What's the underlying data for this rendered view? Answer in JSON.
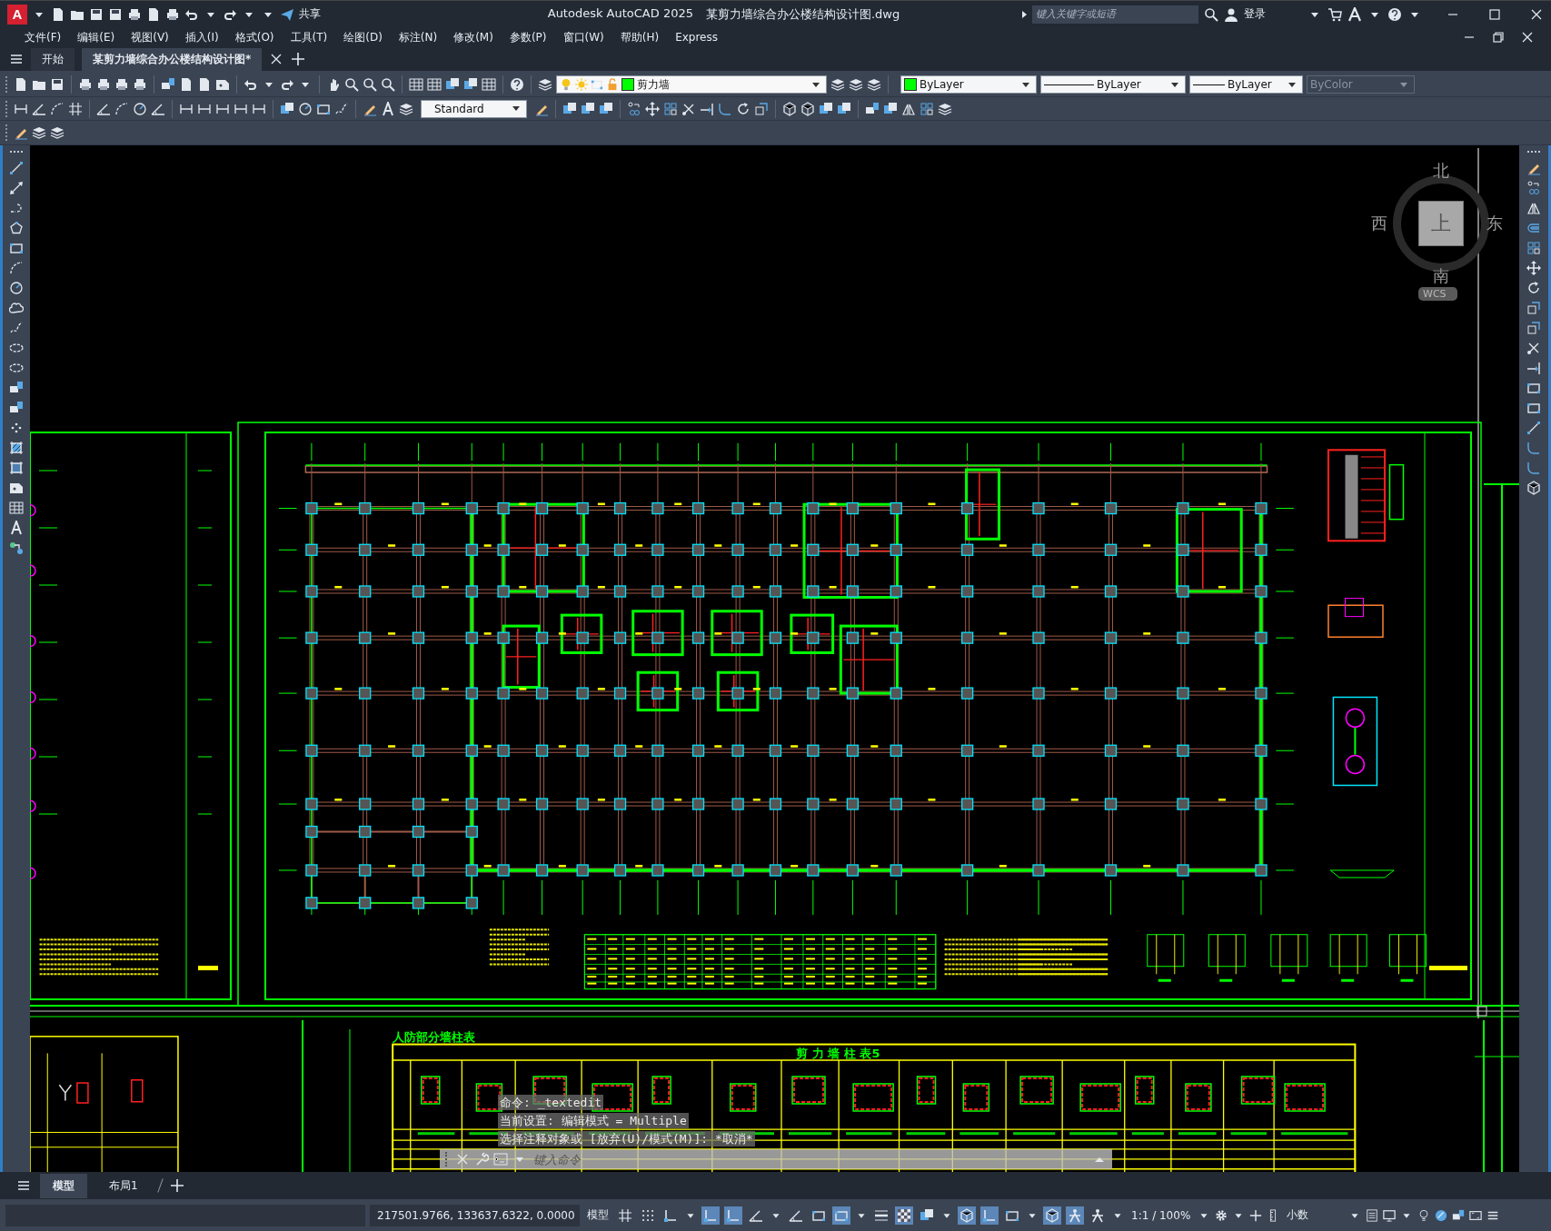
{
  "title_bar": {
    "logo": "A",
    "share": "共享",
    "app_title": "Autodesk AutoCAD 2025",
    "file_name": "某剪力墙综合办公楼结构设计图.dwg",
    "search": {
      "placeholder": "键入关键字或短语"
    },
    "sign_in": "登录"
  },
  "menu_bar": [
    "文件(F)",
    "编辑(E)",
    "视图(V)",
    "插入(I)",
    "格式(O)",
    "工具(T)",
    "绘图(D)",
    "标注(N)",
    "修改(M)",
    "参数(P)",
    "窗口(W)",
    "帮助(H)",
    "Express"
  ],
  "doc_tabs": [
    {
      "label": "开始",
      "selected": false
    },
    {
      "label": "某剪力墙综合办公楼结构设计图*",
      "selected": true
    }
  ],
  "properties": {
    "layer": {
      "name": "剪力墙",
      "color": "#00ff00"
    },
    "color": {
      "value": "ByLayer",
      "color": "#00ff00"
    },
    "linetype": "ByLayer",
    "lineweight": "ByLayer",
    "plot_style": {
      "value": "ByColor",
      "disabled": true
    },
    "text_style": "Standard"
  },
  "viewcube": {
    "north": "北",
    "west": "西",
    "east": "东",
    "south": "南",
    "face": "上",
    "ucs": "WCS"
  },
  "drawing": {
    "table_caption": "人防部分墙柱表",
    "table_title": "剪 力 墙 柱 表5"
  },
  "command_line": {
    "history": [
      "命令: _textedit",
      "当前设置: 编辑模式 = Multiple",
      "选择注释对象或 [放弃(U)/模式(M)]: *取消*"
    ],
    "input": {
      "placeholder": "键入命令"
    }
  },
  "layout_tabs": [
    {
      "label": "模型",
      "selected": true
    },
    {
      "label": "布局1",
      "selected": false
    }
  ],
  "status_bar": {
    "coordinates": "217501.9766, 133637.6322, 0.0000",
    "space": "模型",
    "scale": "1:1 / 100%",
    "units": "小数",
    "toggles": [
      {
        "on": false
      },
      {
        "on": false
      },
      {
        "on": false
      },
      {
        "on": true
      },
      {
        "on": true
      },
      {
        "on": false
      },
      {
        "on": false
      },
      {
        "on": false
      },
      {
        "on": true
      },
      {
        "on": false
      },
      {
        "on": true
      },
      {
        "on": false
      },
      {
        "on": true
      },
      {
        "on": true
      },
      {
        "on": false
      },
      {
        "on": true
      },
      {
        "on": true
      },
      {
        "on": false
      }
    ]
  }
}
